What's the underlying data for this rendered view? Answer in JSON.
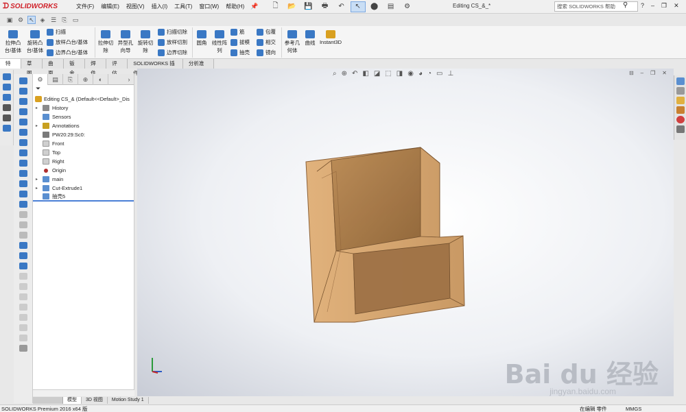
{
  "app": {
    "brand": "SOLIDWORKS",
    "doc_title": "Editing CS_&_*"
  },
  "menu": [
    "文件(F)",
    "编辑(E)",
    "视图(V)",
    "插入(I)",
    "工具(T)",
    "窗口(W)",
    "帮助(H)"
  ],
  "search": {
    "placeholder": "搜索 SOLIDWORKS 帮助"
  },
  "ribbon": {
    "big": [
      {
        "label": "拉伸凸\n台/基体",
        "color": "#3a78c4"
      },
      {
        "label": "旋转凸\n台/基体",
        "color": "#3a78c4"
      },
      {
        "label": "拉伸切\n除",
        "color": "#3a78c4"
      },
      {
        "label": "异型孔\n向导",
        "color": "#3a78c4"
      },
      {
        "label": "旋转切\n除",
        "color": "#3a78c4"
      },
      {
        "label": "圆角",
        "color": "#3a78c4"
      },
      {
        "label": "线性阵\n列",
        "color": "#3a78c4"
      },
      {
        "label": "参考几\n何体",
        "color": "#3a78c4"
      },
      {
        "label": "曲线",
        "color": "#3a78c4"
      },
      {
        "label": "Instant3D",
        "color": "#d9a020"
      }
    ],
    "small": {
      "sweep": "扫描",
      "loft": "放样凸台/基体",
      "boundary": "边界凸台/基体",
      "sweep_cut": "扫描切除",
      "loft_cut": "放样切割",
      "boundary_cut": "边界切除",
      "rib": "筋",
      "draft": "拔模",
      "shell": "抽壳",
      "wrap": "包覆",
      "intersect": "相交",
      "mirror": "镜向"
    }
  },
  "tabs": [
    "特征",
    "草图",
    "曲面",
    "钣金",
    "焊件",
    "评估",
    "SOLIDWORKS 插件",
    "分析准备"
  ],
  "tree": {
    "root": "Editing CS_&  (Default<<Default>_Dis",
    "items": [
      {
        "label": "History",
        "expand": true,
        "color": "#8a8a8a"
      },
      {
        "label": "Sensors",
        "expand": false,
        "color": "#5a8fd0"
      },
      {
        "label": "Annotations",
        "expand": true,
        "color": "#c8a020"
      },
      {
        "label": "PW20:29:Sc0:",
        "expand": false,
        "color": "#7a7a7a"
      },
      {
        "label": "Front",
        "expand": false,
        "color": "#cfcfcf"
      },
      {
        "label": "Top",
        "expand": false,
        "color": "#cfcfcf"
      },
      {
        "label": "Right",
        "expand": false,
        "color": "#cfcfcf"
      },
      {
        "label": "Origin",
        "expand": false,
        "color": "#b03030"
      },
      {
        "label": "main",
        "expand": true,
        "color": "#5a8fd0"
      },
      {
        "label": "Cut-Extrude1",
        "expand": true,
        "color": "#5a8fd0"
      },
      {
        "label": "抽壳5",
        "expand": false,
        "color": "#5a8fd0"
      }
    ]
  },
  "bottom_tabs": [
    "模型",
    "3D 视图",
    "Motion Study 1"
  ],
  "status": {
    "left": "SOLIDWORKS Premium 2016 x64 版",
    "editing": "在编辑 零件",
    "units": "MMGS"
  },
  "watermark": {
    "main": "Bai du 经验",
    "sub": "jingyan.baidu.com"
  }
}
